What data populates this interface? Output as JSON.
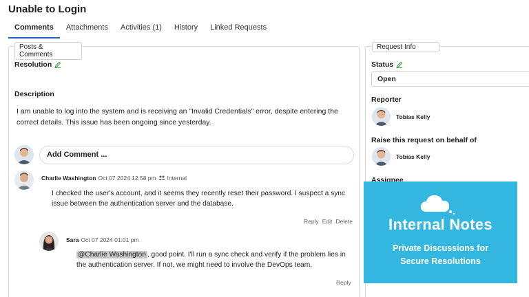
{
  "page": {
    "title": "Unable to Login"
  },
  "tabs": [
    {
      "label": "Comments",
      "active": true
    },
    {
      "label": "Attachments"
    },
    {
      "label": "Activities (1)"
    },
    {
      "label": "History"
    },
    {
      "label": "Linked Requests"
    }
  ],
  "posts_panel": {
    "legend": "Posts & Comments",
    "resolution_label": "Resolution",
    "description_label": "Description",
    "description_text": "I am unable to log into the system and is receiving an \"Invalid Credentials\" error, despite entering the correct details. This issue has been ongoing since yesterday.",
    "add_comment_placeholder": "Add Comment ..."
  },
  "comments": [
    {
      "author": "Charlie Washington",
      "timestamp": "Oct 07 2024 12:58 pm",
      "visibility": "Internal",
      "body": "I checked the user's account, and it seems they recently reset their password. I suspect a sync issue between the authentication server and the database.",
      "actions": [
        "Reply",
        "Edit",
        "Delete"
      ]
    },
    {
      "author": "Sara",
      "timestamp": "Oct 07 2024 01:01 pm",
      "mention": "@Charlie Washington",
      "body_after_mention": ", good point. I'll run a sync check and verify if the problem lies in the authentication server. If not, we might need to involve the DevOps team.",
      "actions": [
        "Reply"
      ]
    }
  ],
  "request_info": {
    "legend": "Request Info",
    "status_label": "Status",
    "status_value": "Open",
    "reporter_label": "Reporter",
    "reporter_name": "Tobias Kelly",
    "behalf_label": "Raise this request on behalf of",
    "behalf_name": "Tobias Kelly",
    "assignee_label": "Assignee"
  },
  "overlay": {
    "title": "Internal Notes",
    "subtitle_line1": "Private Discussions for",
    "subtitle_line2": "Secure Resolutions",
    "color": "#33b6e0"
  },
  "icons": [
    "pencil-icon",
    "internal-people-icon",
    "cloud-icon"
  ]
}
